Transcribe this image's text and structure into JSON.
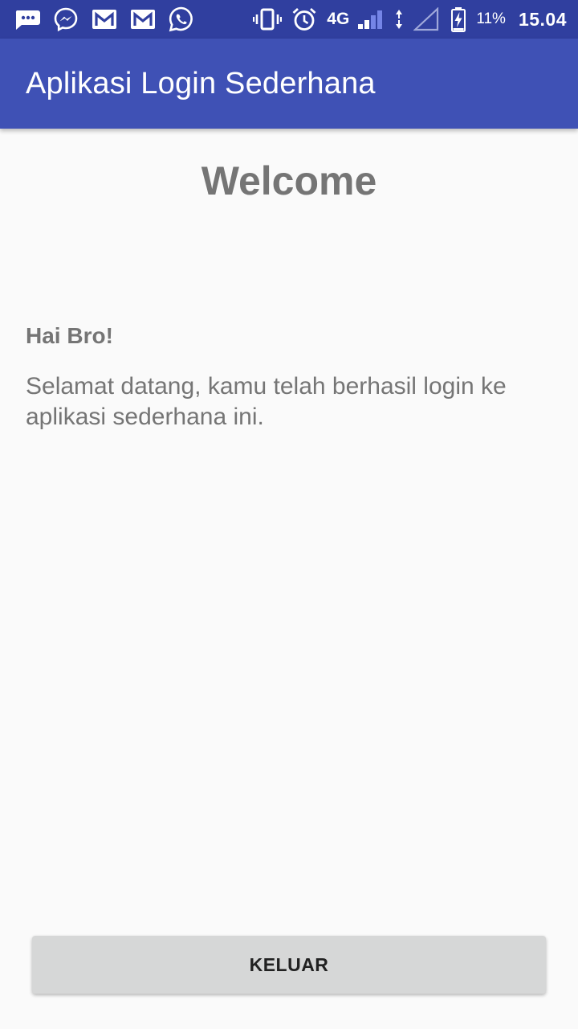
{
  "status_bar": {
    "left_icons": [
      "message-bubble-icon",
      "messenger-icon",
      "gmail-icon",
      "gmail-icon",
      "whatsapp-icon"
    ],
    "right_icons": [
      "vibrate-icon",
      "alarm-icon",
      "signal-bars-icon",
      "data-arrows-icon",
      "no-signal-icon",
      "battery-charging-icon"
    ],
    "network": "4G",
    "battery": "11%",
    "time": "15.04"
  },
  "app_bar": {
    "title": "Aplikasi Login Sederhana",
    "color": "#3f51b5"
  },
  "main": {
    "heading": "Welcome",
    "greeting": "Hai Bro!",
    "message": "Selamat datang, kamu telah berhasil login ke aplikasi sederhana ini."
  },
  "actions": {
    "logout_label": "KELUAR"
  },
  "colors": {
    "status_bar": "#303f9f",
    "primary": "#3f51b5",
    "text": "#757575",
    "button": "#d6d7d7"
  }
}
